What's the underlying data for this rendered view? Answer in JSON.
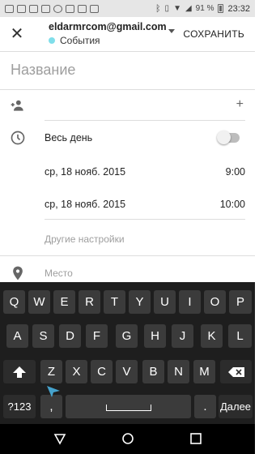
{
  "status_bar": {
    "battery": "91 %",
    "time": "23:32"
  },
  "header": {
    "account": "eldarmrcom@gmail.com",
    "calendar": "События",
    "save_label": "СОХРАНИТЬ"
  },
  "form": {
    "title_placeholder": "Название",
    "all_day_label": "Весь день",
    "all_day_on": false,
    "start_date": "ср, 18 нояб. 2015",
    "start_time": "9:00",
    "end_date": "ср, 18 нояб. 2015",
    "end_time": "10:00",
    "more_options": "Другие настройки",
    "location_placeholder": "Место"
  },
  "keyboard": {
    "row1": [
      "Q",
      "W",
      "E",
      "R",
      "T",
      "Y",
      "U",
      "I",
      "O",
      "P"
    ],
    "row2": [
      "A",
      "S",
      "D",
      "F",
      "G",
      "H",
      "J",
      "K",
      "L"
    ],
    "row3": [
      "Z",
      "X",
      "C",
      "V",
      "B",
      "N",
      "M"
    ],
    "symbols_label": "?123",
    "comma": ",",
    "period": ".",
    "done_label": "Далее"
  },
  "colors": {
    "calendar_dot": "#80deea",
    "keyboard_bg": "#1e1e1e",
    "key_bg": "#3b3b3b"
  }
}
